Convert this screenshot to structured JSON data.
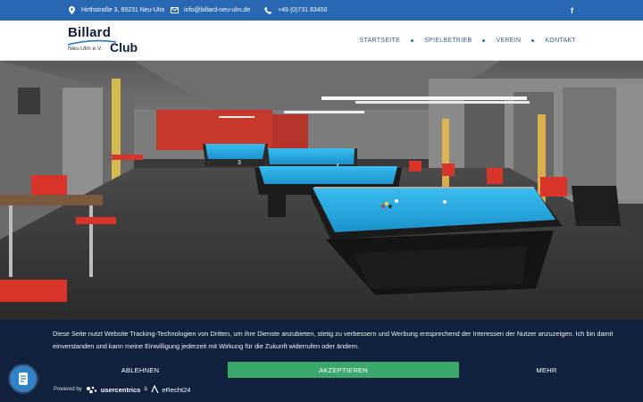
{
  "topbar": {
    "address": "Hirthstraße 3, 89231 Neu-Ulm",
    "email": "info@billard-neu-ulm.de",
    "phone": "+49 (0)731 83450",
    "facebook_icon": "f"
  },
  "logo": {
    "word1": "Billard",
    "word2": "Club",
    "sub": "Neu-Ulm e.V."
  },
  "nav": {
    "items": [
      "STARTSEITE",
      "SPIELBETRIEB",
      "VEREIN",
      "KONTAKT"
    ]
  },
  "hero": {
    "table_numbers": [
      "3",
      "4"
    ]
  },
  "consent": {
    "text": "Diese Seite nutzt Website Tracking-Technologien von Dritten, um ihre Dienste anzubieten, stetig zu verbessern und Werbung entsprechend der Interessen der Nutzer anzuzeigen. Ich bin damit einverstanden und kann meine Einwilligung jederzeit mit Wirkung für die Zukunft widerrufen oder ändern.",
    "decline_label": "ABLEHNEN",
    "accept_label": "AKZEPTIEREN",
    "more_label": "MEHR",
    "powered_by": "Powered by",
    "brand1": "usercentrics",
    "ampersand": "&",
    "brand2": "eRecht24"
  },
  "colors": {
    "topbar": "#2868b3",
    "nav_text": "#2c5f9d",
    "consent_bg": "#10203d",
    "accept": "#3aa76d",
    "table_cloth": "#29a9df",
    "accent_red": "#d8342a"
  }
}
